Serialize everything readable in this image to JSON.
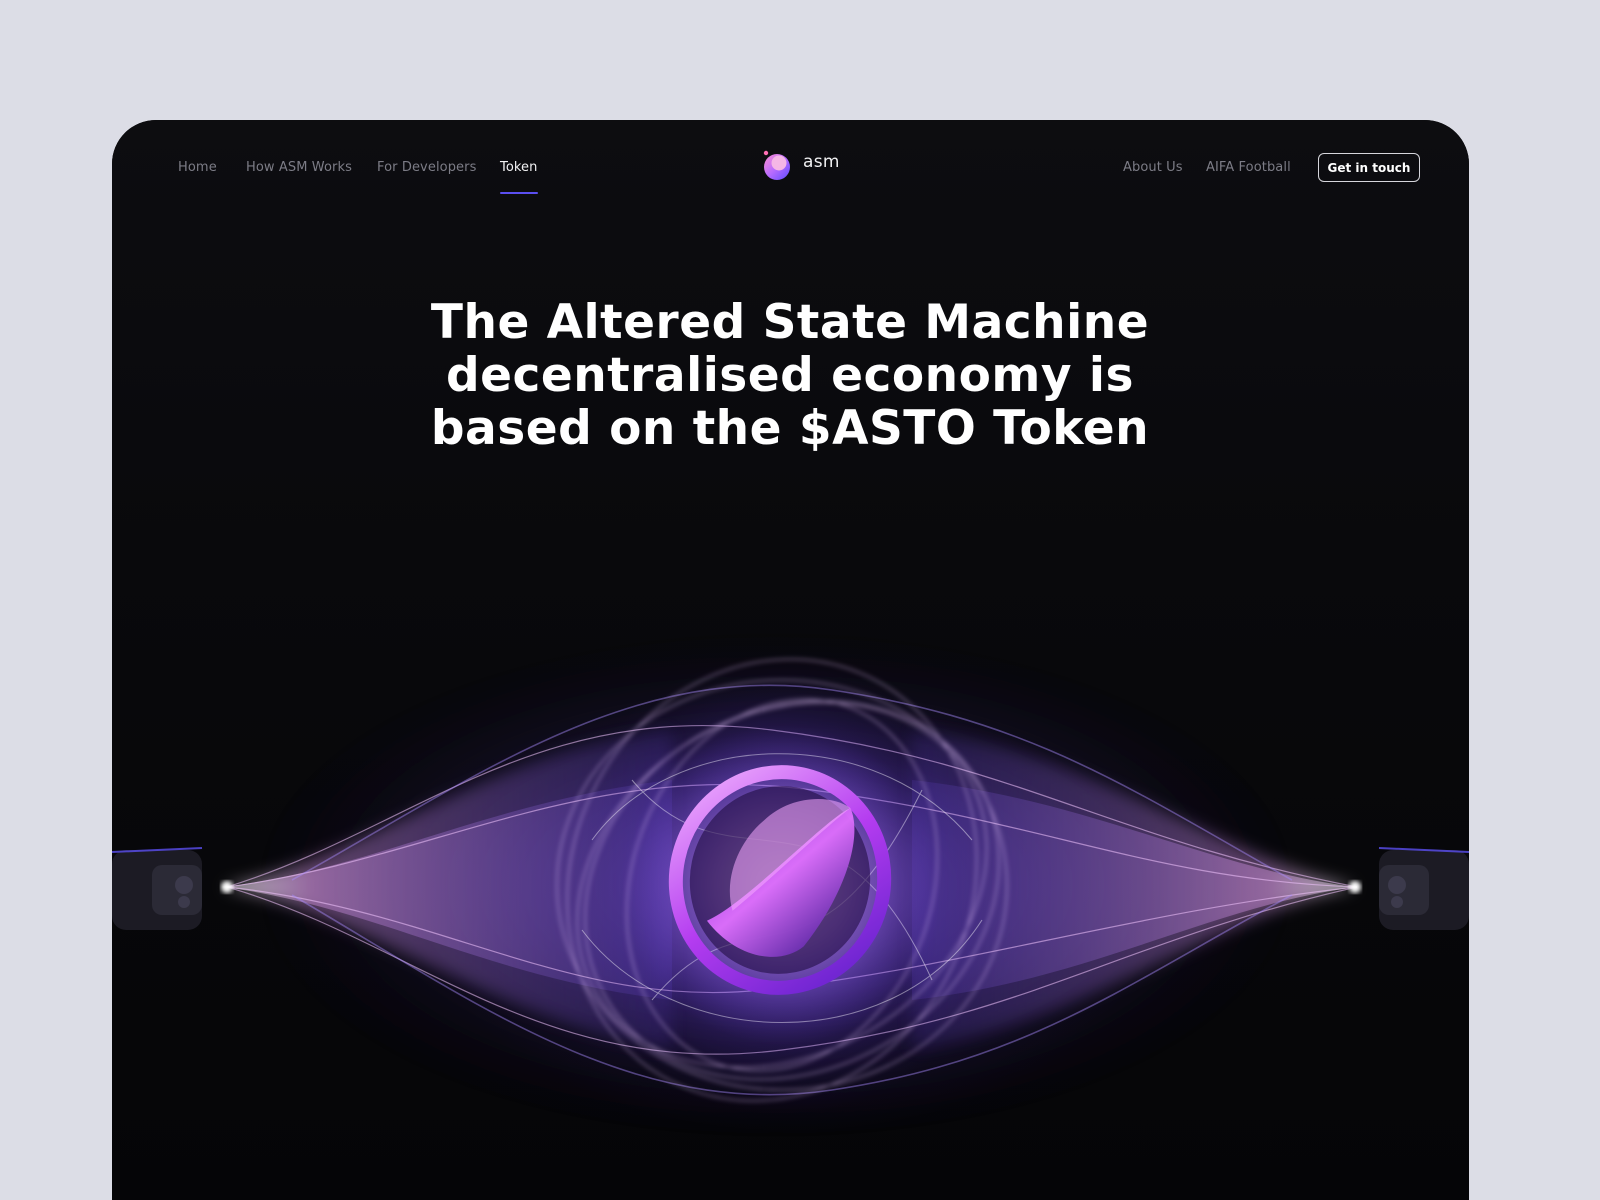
{
  "nav": {
    "left_items": [
      {
        "label": "Home",
        "active": false
      },
      {
        "label": "How ASM Works",
        "active": false
      },
      {
        "label": "For Developers",
        "active": false
      },
      {
        "label": "Token",
        "active": true
      }
    ],
    "right_items": [
      {
        "label": "About Us"
      },
      {
        "label": "AIFA Football"
      }
    ],
    "cta_label": "Get in touch"
  },
  "logo": {
    "text": "asm",
    "icon": "asm-orb-icon"
  },
  "hero": {
    "headline": "The Altered State Machine decentralised economy is based on the $ASTO Token",
    "visual": "asto-token-energy-orb"
  },
  "colors": {
    "page_background": "#dcdde6",
    "frame_background": "#0c0c0f",
    "accent": "#5b4ff0",
    "glow_purple": "#8a5cff",
    "glow_pink": "#e58cff"
  }
}
